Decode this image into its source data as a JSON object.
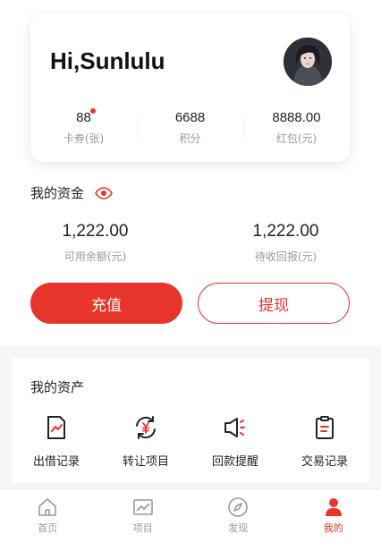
{
  "profile": {
    "greeting": "Hi,Sunlulu",
    "stats": [
      {
        "value": "88",
        "label": "卡券(张)",
        "has_dot": true
      },
      {
        "value": "6688",
        "label": "积分"
      },
      {
        "value": "8888.00",
        "label": "红包(元)"
      }
    ]
  },
  "funds": {
    "title": "我的资金",
    "available": {
      "value": "1,222.00",
      "label": "可用余额(元)"
    },
    "pending": {
      "value": "1,222.00",
      "label": "待收回报(元)"
    },
    "recharge_label": "充值",
    "withdraw_label": "提现"
  },
  "assets": {
    "title": "我的资产",
    "items": [
      {
        "label": "出借记录",
        "icon": "lending-record-icon"
      },
      {
        "label": "转让项目",
        "icon": "transfer-project-icon"
      },
      {
        "label": "回款提醒",
        "icon": "repayment-reminder-icon"
      },
      {
        "label": "交易记录",
        "icon": "transaction-record-icon"
      }
    ]
  },
  "tabbar": {
    "items": [
      {
        "label": "首页",
        "icon": "home-icon"
      },
      {
        "label": "项目",
        "icon": "chart-icon"
      },
      {
        "label": "发现",
        "icon": "compass-icon"
      },
      {
        "label": "我的",
        "icon": "user-icon",
        "active": true
      }
    ]
  },
  "colors": {
    "accent": "#e8352b",
    "muted": "#999999",
    "icon": "#222222"
  }
}
